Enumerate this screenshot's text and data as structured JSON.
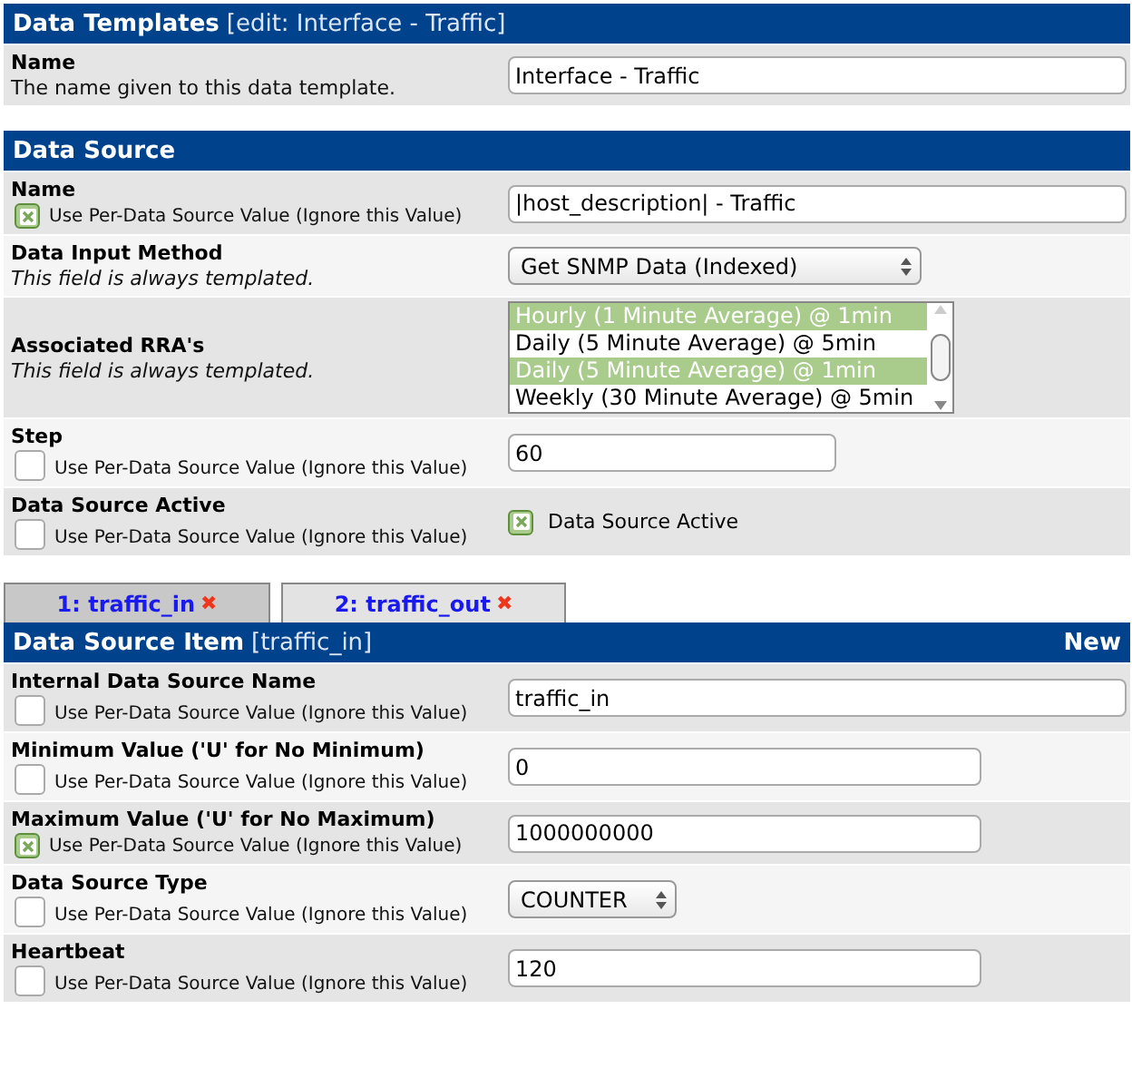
{
  "template_header": {
    "title": "Data Templates",
    "subtitle": "[edit: Interface - Traffic]"
  },
  "template_rows": [
    {
      "kind": "wide-text",
      "label": "Name",
      "description": "The name given to this data template.",
      "value": "Interface - Traffic"
    }
  ],
  "data_source": {
    "title": "Data Source",
    "rows": [
      {
        "kind": "wide-text",
        "label": "Name",
        "per_source": {
          "label": "Use Per-Data Source Value (Ignore this Value)",
          "checked": true
        },
        "value": "|host_description| - Traffic"
      },
      {
        "kind": "select",
        "label": "Data Input Method",
        "description": "This field is always templated.",
        "value": "Get SNMP Data (Indexed)"
      },
      {
        "kind": "listbox",
        "label": "Associated RRA's",
        "description": "This field is always templated.",
        "options": [
          {
            "label": "Hourly (1 Minute Average) @ 1min",
            "selected": true
          },
          {
            "label": "Daily (5 Minute Average) @ 5min",
            "selected": false
          },
          {
            "label": "Daily (5 Minute Average) @ 1min",
            "selected": true
          },
          {
            "label": "Weekly (30 Minute Average) @ 5min",
            "selected": false
          }
        ]
      },
      {
        "kind": "short-text",
        "label": "Step",
        "per_source": {
          "label": "Use Per-Data Source Value (Ignore this Value)",
          "checked": false
        },
        "value": "60"
      },
      {
        "kind": "checkbox",
        "label": "Data Source Active",
        "per_source": {
          "label": "Use Per-Data Source Value (Ignore this Value)",
          "checked": false
        },
        "check_label": "Data Source Active",
        "checked": true
      }
    ]
  },
  "tabs": [
    {
      "label": "1: traffic_in",
      "close": "✖",
      "selected": true
    },
    {
      "label": "2: traffic_out",
      "close": "✖",
      "selected": false
    }
  ],
  "item": {
    "title": "Data Source Item",
    "subtitle": "[traffic_in]",
    "action": "New",
    "rows": [
      {
        "kind": "wide-text",
        "label": "Internal Data Source Name",
        "per_source": {
          "label": "Use Per-Data Source Value (Ignore this Value)",
          "checked": false
        },
        "value": "traffic_in"
      },
      {
        "kind": "text",
        "label": "Minimum Value ('U' for No Minimum)",
        "per_source": {
          "label": "Use Per-Data Source Value (Ignore this Value)",
          "checked": false
        },
        "value": "0"
      },
      {
        "kind": "text",
        "label": "Maximum Value ('U' for No Maximum)",
        "per_source": {
          "label": "Use Per-Data Source Value (Ignore this Value)",
          "checked": true
        },
        "value": "1000000000"
      },
      {
        "kind": "small-select",
        "label": "Data Source Type",
        "per_source": {
          "label": "Use Per-Data Source Value (Ignore this Value)",
          "checked": false
        },
        "value": "COUNTER"
      },
      {
        "kind": "text",
        "label": "Heartbeat",
        "per_source": {
          "label": "Use Per-Data Source Value (Ignore this Value)",
          "checked": false
        },
        "value": "120"
      }
    ]
  }
}
